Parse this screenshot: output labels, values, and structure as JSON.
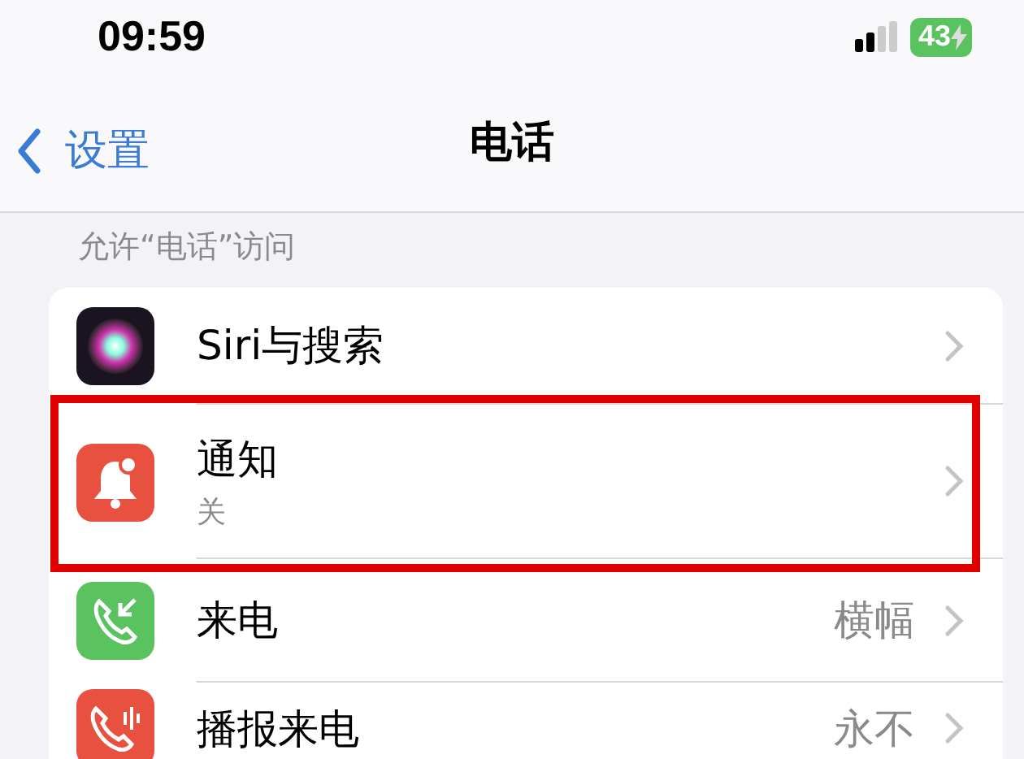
{
  "status_bar": {
    "time": "09:59",
    "battery": "43"
  },
  "nav": {
    "back": "设置",
    "title": "电话"
  },
  "section": {
    "header": "允许“电话”访问",
    "items": [
      {
        "label": "Siri与搜索",
        "highlighted": false
      },
      {
        "label": "通知",
        "subtitle": "关",
        "highlighted": true
      },
      {
        "label": "来电",
        "value": "横幅",
        "highlighted": false
      },
      {
        "label": "播报来电",
        "value": "永不",
        "highlighted": false
      }
    ]
  }
}
